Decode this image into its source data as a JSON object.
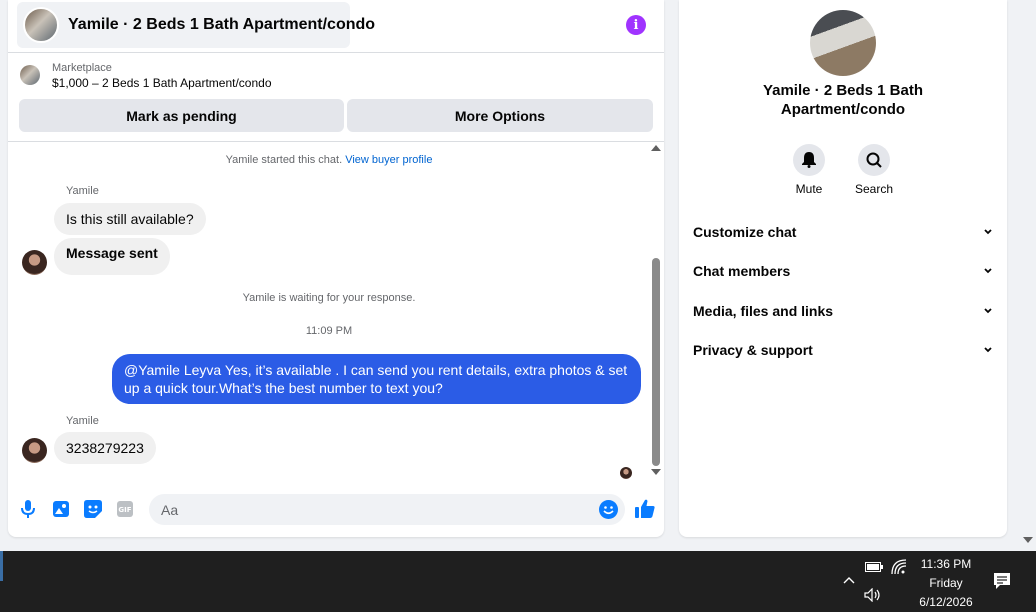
{
  "chat": {
    "header_title": "Yamile · 2 Beds 1 Bath Apartment/condo",
    "info_icon": "info-icon",
    "marketplace_label": "Marketplace",
    "listing_price_title": "$1,000 – 2 Beds 1 Bath Apartment/condo",
    "mark_pending_label": "Mark as pending",
    "more_options_label": "More Options",
    "started_text": "Yamile started this chat.",
    "buyer_profile_link": "View buyer profile",
    "sender_name_1": "Yamile",
    "msg_1": "Is this still available?",
    "msg_2": "Message sent",
    "waiting_text": "Yamile is waiting for your response.",
    "timestamp": "11:09 PM",
    "outgoing_msg": "@Yamile Leyva Yes, it’s available .  I can send you rent details, extra photos & set up a quick tour.What’s the best number to text you?",
    "sender_name_2": "Yamile",
    "msg_3": "3238279223",
    "input_placeholder": "Aa"
  },
  "panel": {
    "title": "Yamile · 2 Beds 1 Bath Apartment/condo",
    "mute_label": "Mute",
    "search_label": "Search",
    "menu": [
      {
        "label": "Customize chat"
      },
      {
        "label": "Chat members"
      },
      {
        "label": "Media, files and links"
      },
      {
        "label": "Privacy & support"
      }
    ]
  },
  "taskbar": {
    "time": "11:36 PM",
    "day": "Friday",
    "date": "6/12/2026"
  },
  "colors": {
    "accent": "#2b5ce6",
    "info_purple": "#a033ff",
    "link": "#0064d1"
  }
}
